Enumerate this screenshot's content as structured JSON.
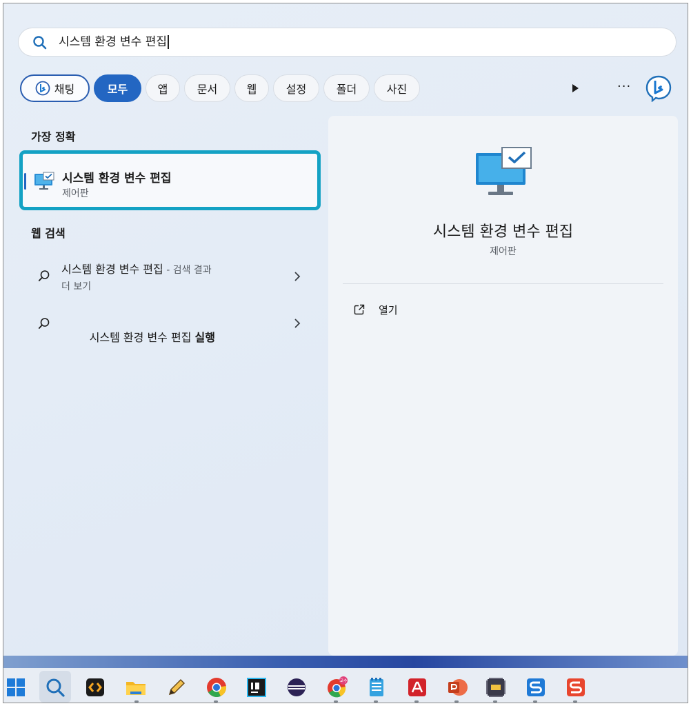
{
  "search": {
    "query": "시스템 환경 변수 편집"
  },
  "filters": {
    "chat_label": "채팅",
    "items": [
      "모두",
      "앱",
      "문서",
      "웹",
      "설정",
      "폴더",
      "사진"
    ],
    "more_label": "···"
  },
  "best_match": {
    "heading": "가장 정확",
    "title": "시스템 환경 변수 편집",
    "subtitle": "제어판"
  },
  "web_search": {
    "heading": "웹 검색",
    "items": [
      {
        "title": "시스템 환경 변수 편집",
        "suffix": " - 검색 결과",
        "line2": "더 보기"
      },
      {
        "title": "시스템 환경 변수 편집 ",
        "bold": "실행"
      }
    ]
  },
  "preview": {
    "title": "시스템 환경 변수 편집",
    "subtitle": "제어판",
    "open_label": "열기"
  },
  "taskbar": {
    "icons": [
      "windows-start-icon",
      "search-icon",
      "app-switch-icon",
      "file-explorer-icon",
      "pencil-icon",
      "chrome-icon",
      "intellij-icon",
      "eclipse-icon",
      "chrome-profile-icon",
      "notepad-icon",
      "acrobat-icon",
      "powerpoint-icon",
      "ide-icon",
      "app-s-blue-icon",
      "app-s-red-icon"
    ],
    "badge": "교수"
  },
  "colors": {
    "accent": "#2366c2",
    "highlight_border": "#14a2c4",
    "panel_bg": "#e4ecf6"
  }
}
